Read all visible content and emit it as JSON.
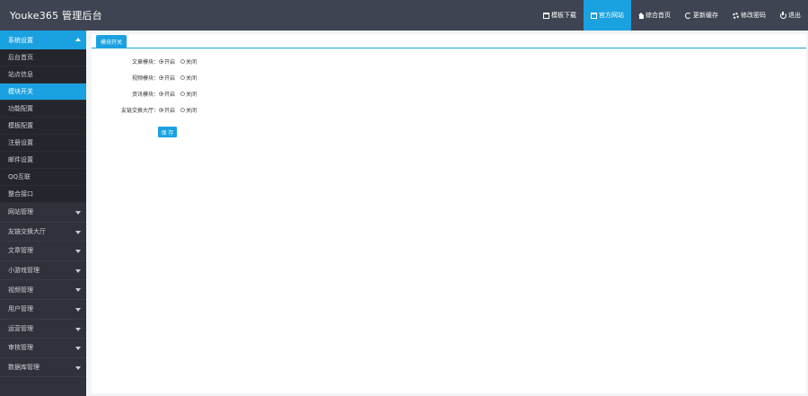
{
  "app": {
    "title": "Youke365 管理后台"
  },
  "topnav": {
    "items": [
      {
        "label": "模板下载",
        "icon": "window-icon",
        "active": false
      },
      {
        "label": "官方网站",
        "icon": "window-icon",
        "active": true
      },
      {
        "label": "综合首页",
        "icon": "home-icon",
        "active": false
      },
      {
        "label": "更新缓存",
        "icon": "refresh-icon",
        "active": false
      },
      {
        "label": "修改密码",
        "icon": "gear-icon",
        "active": false
      },
      {
        "label": "退出",
        "icon": "power-icon",
        "active": false
      }
    ]
  },
  "sidebar": {
    "open_group": "系统设置",
    "sub_items": [
      "后台首页",
      "站点信息",
      "模块开关",
      "功能配置",
      "模板配置",
      "注册设置",
      "邮件设置",
      "QQ互联",
      "整合接口"
    ],
    "active_sub_index": 2,
    "groups": [
      "网站管理",
      "友链交换大厅",
      "文章管理",
      "小游戏管理",
      "视频管理",
      "用户管理",
      "运营管理",
      "审核管理",
      "数据库管理"
    ]
  },
  "main": {
    "tab_label": "模块开关",
    "rows": [
      {
        "label": "文章模块：",
        "on_label": "开启",
        "off_label": "关闭",
        "value": "on"
      },
      {
        "label": "视频模块：",
        "on_label": "开启",
        "off_label": "关闭",
        "value": "on"
      },
      {
        "label": "资讯模块：",
        "on_label": "开启",
        "off_label": "关闭",
        "value": "on"
      },
      {
        "label": "友链交换大厅：",
        "on_label": "开启",
        "off_label": "关闭",
        "value": "on"
      }
    ],
    "save_label": "保 存"
  },
  "colors": {
    "accent": "#1aa1e0",
    "topbar": "#3f4452",
    "sidebar": "#2f323b"
  }
}
